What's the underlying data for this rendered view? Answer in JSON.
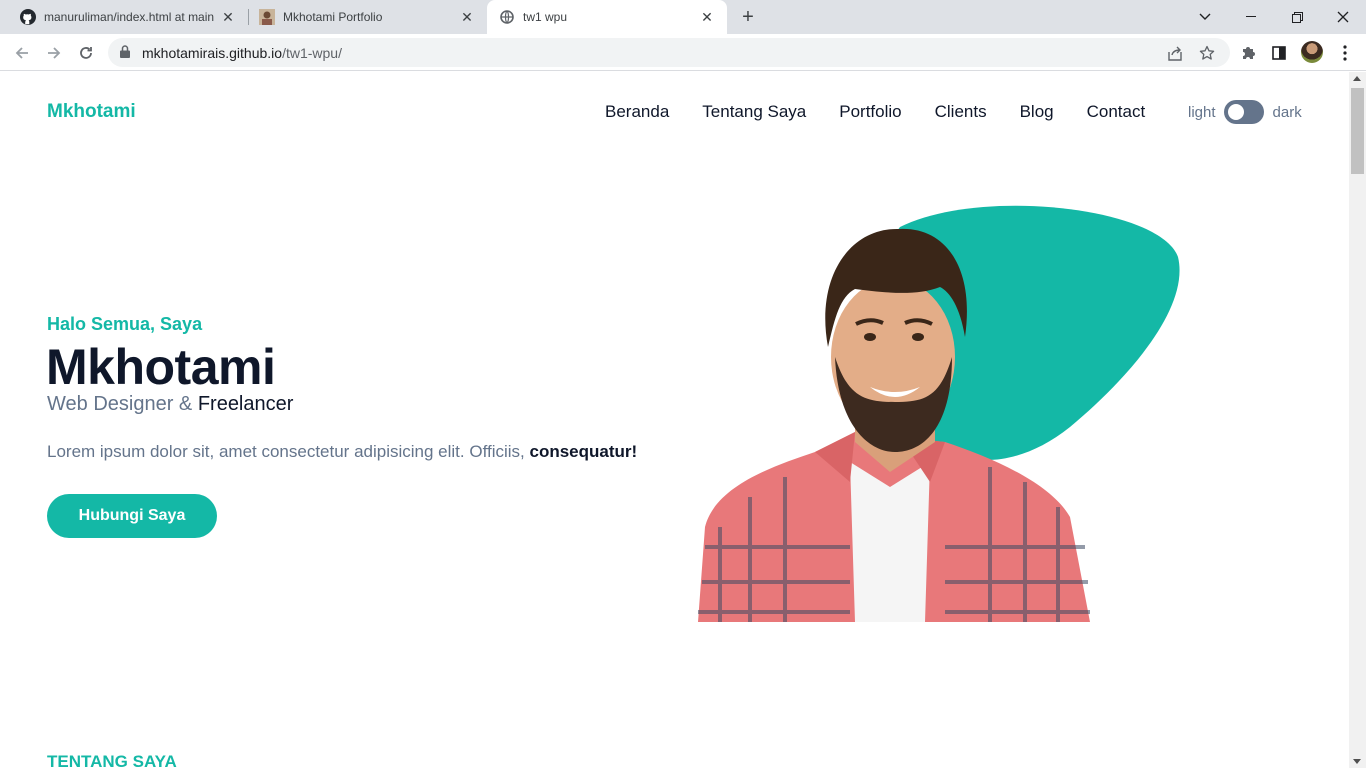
{
  "browser": {
    "tabs": [
      {
        "title": "manuruliman/index.html at main",
        "favicon": "github-icon"
      },
      {
        "title": "Mkhotami Portfolio",
        "favicon": "portrait-thumbnail"
      },
      {
        "title": "tw1 wpu",
        "favicon": "globe-icon",
        "active": true
      }
    ],
    "url_host": "mkhotamirais.github.io",
    "url_path": "/tw1-wpu/"
  },
  "site": {
    "brand": "Mkhotami",
    "nav": [
      "Beranda",
      "Tentang Saya",
      "Portfolio",
      "Clients",
      "Blog",
      "Contact"
    ],
    "theme_light": "light",
    "theme_dark": "dark",
    "theme_mode": "light"
  },
  "hero": {
    "greeting": "Halo Semua, Saya",
    "name": "Mkhotami",
    "role_a": "Web Designer",
    "role_sep": " & ",
    "role_b": "Freelancer",
    "lead_text": "Lorem ipsum dolor sit, amet consectetur adipisicing elit. Officiis, ",
    "lead_bold": "consequatur!",
    "cta": "Hubungi Saya"
  },
  "about": {
    "section_title": "TENTANG SAYA"
  },
  "colors": {
    "accent": "#14b8a6",
    "dark_text": "#0f172a",
    "muted_text": "#64748b"
  }
}
